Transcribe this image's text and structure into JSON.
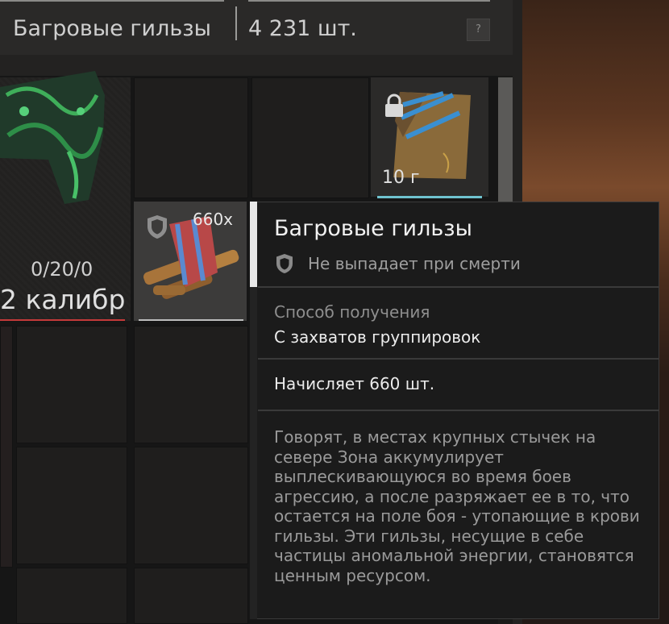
{
  "header": {
    "item_name": "Багровые гильзы",
    "count": "4 231 шт.",
    "help_label": "?"
  },
  "weapon": {
    "durability": "0/20/0",
    "caliber": "2 калибр"
  },
  "locked_item": {
    "weight": "10 г"
  },
  "shells_item": {
    "quantity": "660x"
  },
  "tooltip": {
    "title": "Багровые гильзы",
    "no_drop": "Не выпадает при смерти",
    "source_label": "Способ получения",
    "source_value": "С захватов группировок",
    "credit": "Начисляет 660 шт.",
    "description": "Говорят, в местах крупных стычек на севере Зона аккумулирует выплескивающуюся во время боев агрессию, а после разряжает ее в то, что остается на поле боя - утопающие в крови гильзы. Эти гильзы, несущие в себе частицы аномальной энергии, становятся ценным ресурсом."
  },
  "colors": {
    "weapon_bar": "#c43a3a",
    "locked_bar": "#6fc3cf",
    "tooltip_accent": "#e8e8e8"
  },
  "icons": [
    "help-icon",
    "lock-icon",
    "shield-icon"
  ]
}
